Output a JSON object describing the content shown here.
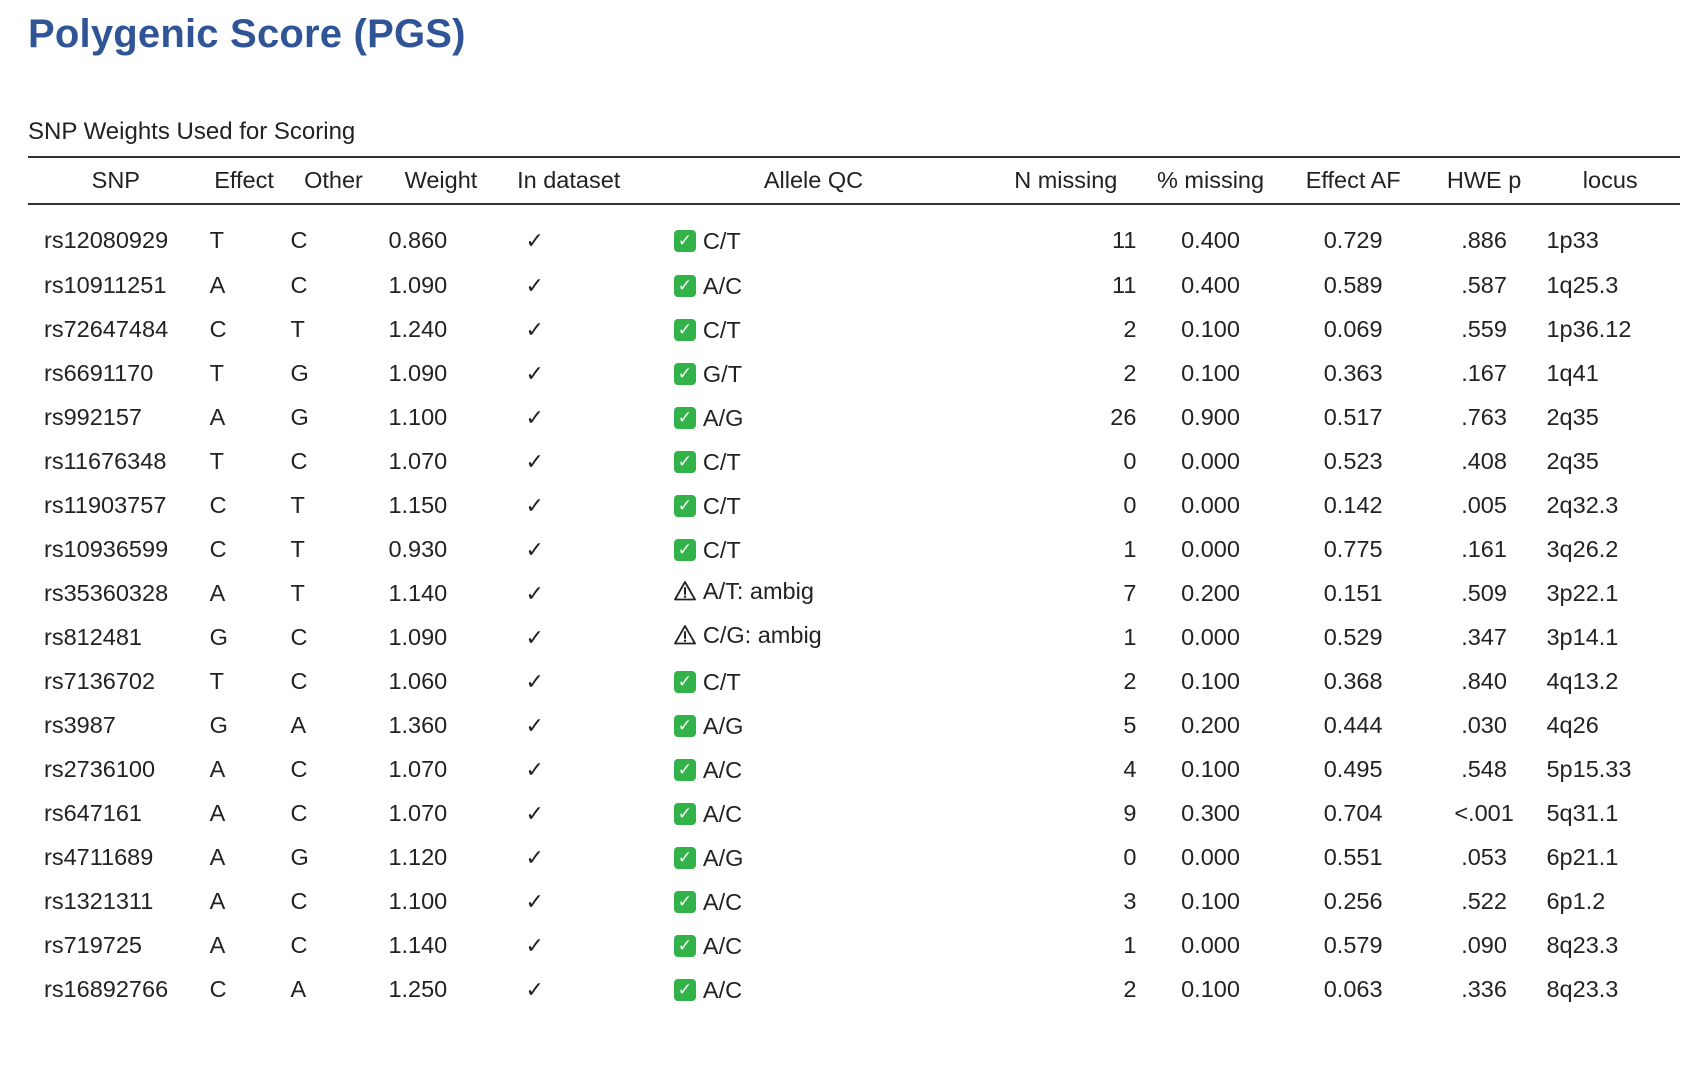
{
  "header": {
    "title": "Polygenic Score (PGS)",
    "caption": "SNP Weights Used for Scoring"
  },
  "colors": {
    "title": "#2f5597",
    "qc_ok": "#33b24a"
  },
  "table": {
    "columns": [
      "SNP",
      "Effect",
      "Other",
      "Weight",
      "In dataset",
      "Allele QC",
      "N missing",
      "% missing",
      "Effect AF",
      "HWE p",
      "locus"
    ],
    "rows": [
      {
        "snp": "rs12080929",
        "effect": "T",
        "other": "C",
        "weight": "0.860",
        "in_dataset": "✓",
        "qc_status": "ok",
        "qc_icon": "green-check-icon",
        "qc_text": "C/T",
        "n_missing": "11",
        "pct_missing": "0.400",
        "effect_af": "0.729",
        "hwe_p": ".886",
        "locus": "1p33"
      },
      {
        "snp": "rs10911251",
        "effect": "A",
        "other": "C",
        "weight": "1.090",
        "in_dataset": "✓",
        "qc_status": "ok",
        "qc_icon": "green-check-icon",
        "qc_text": "A/C",
        "n_missing": "11",
        "pct_missing": "0.400",
        "effect_af": "0.589",
        "hwe_p": ".587",
        "locus": "1q25.3"
      },
      {
        "snp": "rs72647484",
        "effect": "C",
        "other": "T",
        "weight": "1.240",
        "in_dataset": "✓",
        "qc_status": "ok",
        "qc_icon": "green-check-icon",
        "qc_text": "C/T",
        "n_missing": "2",
        "pct_missing": "0.100",
        "effect_af": "0.069",
        "hwe_p": ".559",
        "locus": "1p36.12"
      },
      {
        "snp": "rs6691170",
        "effect": "T",
        "other": "G",
        "weight": "1.090",
        "in_dataset": "✓",
        "qc_status": "ok",
        "qc_icon": "green-check-icon",
        "qc_text": "G/T",
        "n_missing": "2",
        "pct_missing": "0.100",
        "effect_af": "0.363",
        "hwe_p": ".167",
        "locus": "1q41"
      },
      {
        "snp": "rs992157",
        "effect": "A",
        "other": "G",
        "weight": "1.100",
        "in_dataset": "✓",
        "qc_status": "ok",
        "qc_icon": "green-check-icon",
        "qc_text": "A/G",
        "n_missing": "26",
        "pct_missing": "0.900",
        "effect_af": "0.517",
        "hwe_p": ".763",
        "locus": "2q35"
      },
      {
        "snp": "rs11676348",
        "effect": "T",
        "other": "C",
        "weight": "1.070",
        "in_dataset": "✓",
        "qc_status": "ok",
        "qc_icon": "green-check-icon",
        "qc_text": "C/T",
        "n_missing": "0",
        "pct_missing": "0.000",
        "effect_af": "0.523",
        "hwe_p": ".408",
        "locus": "2q35"
      },
      {
        "snp": "rs11903757",
        "effect": "C",
        "other": "T",
        "weight": "1.150",
        "in_dataset": "✓",
        "qc_status": "ok",
        "qc_icon": "green-check-icon",
        "qc_text": "C/T",
        "n_missing": "0",
        "pct_missing": "0.000",
        "effect_af": "0.142",
        "hwe_p": ".005",
        "locus": "2q32.3"
      },
      {
        "snp": "rs10936599",
        "effect": "C",
        "other": "T",
        "weight": "0.930",
        "in_dataset": "✓",
        "qc_status": "ok",
        "qc_icon": "green-check-icon",
        "qc_text": "C/T",
        "n_missing": "1",
        "pct_missing": "0.000",
        "effect_af": "0.775",
        "hwe_p": ".161",
        "locus": "3q26.2"
      },
      {
        "snp": "rs35360328",
        "effect": "A",
        "other": "T",
        "weight": "1.140",
        "in_dataset": "✓",
        "qc_status": "warn",
        "qc_icon": "warning-icon",
        "qc_text": "A/T: ambig",
        "n_missing": "7",
        "pct_missing": "0.200",
        "effect_af": "0.151",
        "hwe_p": ".509",
        "locus": "3p22.1"
      },
      {
        "snp": "rs812481",
        "effect": "G",
        "other": "C",
        "weight": "1.090",
        "in_dataset": "✓",
        "qc_status": "warn",
        "qc_icon": "warning-icon",
        "qc_text": "C/G: ambig",
        "n_missing": "1",
        "pct_missing": "0.000",
        "effect_af": "0.529",
        "hwe_p": ".347",
        "locus": "3p14.1"
      },
      {
        "snp": "rs7136702",
        "effect": "T",
        "other": "C",
        "weight": "1.060",
        "in_dataset": "✓",
        "qc_status": "ok",
        "qc_icon": "green-check-icon",
        "qc_text": "C/T",
        "n_missing": "2",
        "pct_missing": "0.100",
        "effect_af": "0.368",
        "hwe_p": ".840",
        "locus": "4q13.2"
      },
      {
        "snp": "rs3987",
        "effect": "G",
        "other": "A",
        "weight": "1.360",
        "in_dataset": "✓",
        "qc_status": "ok",
        "qc_icon": "green-check-icon",
        "qc_text": "A/G",
        "n_missing": "5",
        "pct_missing": "0.200",
        "effect_af": "0.444",
        "hwe_p": ".030",
        "locus": "4q26"
      },
      {
        "snp": "rs2736100",
        "effect": "A",
        "other": "C",
        "weight": "1.070",
        "in_dataset": "✓",
        "qc_status": "ok",
        "qc_icon": "green-check-icon",
        "qc_text": "A/C",
        "n_missing": "4",
        "pct_missing": "0.100",
        "effect_af": "0.495",
        "hwe_p": ".548",
        "locus": "5p15.33"
      },
      {
        "snp": "rs647161",
        "effect": "A",
        "other": "C",
        "weight": "1.070",
        "in_dataset": "✓",
        "qc_status": "ok",
        "qc_icon": "green-check-icon",
        "qc_text": "A/C",
        "n_missing": "9",
        "pct_missing": "0.300",
        "effect_af": "0.704",
        "hwe_p": "<.001",
        "locus": "5q31.1"
      },
      {
        "snp": "rs4711689",
        "effect": "A",
        "other": "G",
        "weight": "1.120",
        "in_dataset": "✓",
        "qc_status": "ok",
        "qc_icon": "green-check-icon",
        "qc_text": "A/G",
        "n_missing": "0",
        "pct_missing": "0.000",
        "effect_af": "0.551",
        "hwe_p": ".053",
        "locus": "6p21.1"
      },
      {
        "snp": "rs1321311",
        "effect": "A",
        "other": "C",
        "weight": "1.100",
        "in_dataset": "✓",
        "qc_status": "ok",
        "qc_icon": "green-check-icon",
        "qc_text": "A/C",
        "n_missing": "3",
        "pct_missing": "0.100",
        "effect_af": "0.256",
        "hwe_p": ".522",
        "locus": "6p1.2"
      },
      {
        "snp": "rs719725",
        "effect": "A",
        "other": "C",
        "weight": "1.140",
        "in_dataset": "✓",
        "qc_status": "ok",
        "qc_icon": "green-check-icon",
        "qc_text": "A/C",
        "n_missing": "1",
        "pct_missing": "0.000",
        "effect_af": "0.579",
        "hwe_p": ".090",
        "locus": "8q23.3"
      },
      {
        "snp": "rs16892766",
        "effect": "C",
        "other": "A",
        "weight": "1.250",
        "in_dataset": "✓",
        "qc_status": "ok",
        "qc_icon": "green-check-icon",
        "qc_text": "A/C",
        "n_missing": "2",
        "pct_missing": "0.100",
        "effect_af": "0.063",
        "hwe_p": ".336",
        "locus": "8q23.3"
      }
    ]
  }
}
